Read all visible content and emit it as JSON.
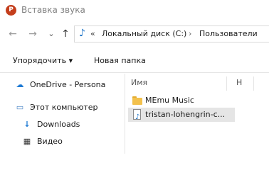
{
  "window": {
    "app_icon_letter": "P",
    "title": "Вставка звука"
  },
  "nav_buttons": {
    "back": "←",
    "forward": "→",
    "recent": "⌄",
    "up": "↑"
  },
  "address_bar": {
    "overflow": "«",
    "segments": [
      "Локальный диск (C:)",
      "Пользователи"
    ],
    "separator": "›"
  },
  "toolbar": {
    "organize": "Упорядочить ▾",
    "new_folder": "Новая папка"
  },
  "nav_pane": {
    "items": [
      {
        "label": "OneDrive - Persona",
        "icon": "cloud-icon"
      },
      {
        "label": "Этот компьютер",
        "icon": "computer-icon"
      },
      {
        "label": "Downloads",
        "icon": "download-icon"
      },
      {
        "label": "Видео",
        "icon": "video-icon"
      }
    ]
  },
  "columns": {
    "name": "Имя",
    "number": "Н"
  },
  "files": [
    {
      "name": "MEmu Music",
      "type": "folder"
    },
    {
      "name": "tristan-lohengrin-c...",
      "type": "audio",
      "selected": true
    }
  ]
}
